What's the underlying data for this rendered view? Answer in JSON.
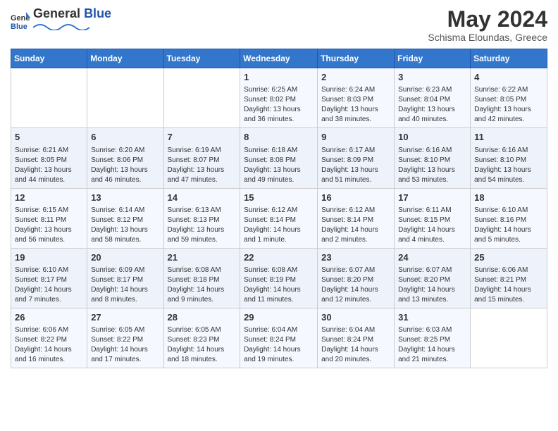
{
  "logo": {
    "text_general": "General",
    "text_blue": "Blue"
  },
  "header": {
    "title": "May 2024",
    "subtitle": "Schisma Eloundas, Greece"
  },
  "weekdays": [
    "Sunday",
    "Monday",
    "Tuesday",
    "Wednesday",
    "Thursday",
    "Friday",
    "Saturday"
  ],
  "weeks": [
    [
      {
        "day": "",
        "lines": []
      },
      {
        "day": "",
        "lines": []
      },
      {
        "day": "",
        "lines": []
      },
      {
        "day": "1",
        "lines": [
          "Sunrise: 6:25 AM",
          "Sunset: 8:02 PM",
          "Daylight: 13 hours",
          "and 36 minutes."
        ]
      },
      {
        "day": "2",
        "lines": [
          "Sunrise: 6:24 AM",
          "Sunset: 8:03 PM",
          "Daylight: 13 hours",
          "and 38 minutes."
        ]
      },
      {
        "day": "3",
        "lines": [
          "Sunrise: 6:23 AM",
          "Sunset: 8:04 PM",
          "Daylight: 13 hours",
          "and 40 minutes."
        ]
      },
      {
        "day": "4",
        "lines": [
          "Sunrise: 6:22 AM",
          "Sunset: 8:05 PM",
          "Daylight: 13 hours",
          "and 42 minutes."
        ]
      }
    ],
    [
      {
        "day": "5",
        "lines": [
          "Sunrise: 6:21 AM",
          "Sunset: 8:05 PM",
          "Daylight: 13 hours",
          "and 44 minutes."
        ]
      },
      {
        "day": "6",
        "lines": [
          "Sunrise: 6:20 AM",
          "Sunset: 8:06 PM",
          "Daylight: 13 hours",
          "and 46 minutes."
        ]
      },
      {
        "day": "7",
        "lines": [
          "Sunrise: 6:19 AM",
          "Sunset: 8:07 PM",
          "Daylight: 13 hours",
          "and 47 minutes."
        ]
      },
      {
        "day": "8",
        "lines": [
          "Sunrise: 6:18 AM",
          "Sunset: 8:08 PM",
          "Daylight: 13 hours",
          "and 49 minutes."
        ]
      },
      {
        "day": "9",
        "lines": [
          "Sunrise: 6:17 AM",
          "Sunset: 8:09 PM",
          "Daylight: 13 hours",
          "and 51 minutes."
        ]
      },
      {
        "day": "10",
        "lines": [
          "Sunrise: 6:16 AM",
          "Sunset: 8:10 PM",
          "Daylight: 13 hours",
          "and 53 minutes."
        ]
      },
      {
        "day": "11",
        "lines": [
          "Sunrise: 6:16 AM",
          "Sunset: 8:10 PM",
          "Daylight: 13 hours",
          "and 54 minutes."
        ]
      }
    ],
    [
      {
        "day": "12",
        "lines": [
          "Sunrise: 6:15 AM",
          "Sunset: 8:11 PM",
          "Daylight: 13 hours",
          "and 56 minutes."
        ]
      },
      {
        "day": "13",
        "lines": [
          "Sunrise: 6:14 AM",
          "Sunset: 8:12 PM",
          "Daylight: 13 hours",
          "and 58 minutes."
        ]
      },
      {
        "day": "14",
        "lines": [
          "Sunrise: 6:13 AM",
          "Sunset: 8:13 PM",
          "Daylight: 13 hours",
          "and 59 minutes."
        ]
      },
      {
        "day": "15",
        "lines": [
          "Sunrise: 6:12 AM",
          "Sunset: 8:14 PM",
          "Daylight: 14 hours",
          "and 1 minute."
        ]
      },
      {
        "day": "16",
        "lines": [
          "Sunrise: 6:12 AM",
          "Sunset: 8:14 PM",
          "Daylight: 14 hours",
          "and 2 minutes."
        ]
      },
      {
        "day": "17",
        "lines": [
          "Sunrise: 6:11 AM",
          "Sunset: 8:15 PM",
          "Daylight: 14 hours",
          "and 4 minutes."
        ]
      },
      {
        "day": "18",
        "lines": [
          "Sunrise: 6:10 AM",
          "Sunset: 8:16 PM",
          "Daylight: 14 hours",
          "and 5 minutes."
        ]
      }
    ],
    [
      {
        "day": "19",
        "lines": [
          "Sunrise: 6:10 AM",
          "Sunset: 8:17 PM",
          "Daylight: 14 hours",
          "and 7 minutes."
        ]
      },
      {
        "day": "20",
        "lines": [
          "Sunrise: 6:09 AM",
          "Sunset: 8:17 PM",
          "Daylight: 14 hours",
          "and 8 minutes."
        ]
      },
      {
        "day": "21",
        "lines": [
          "Sunrise: 6:08 AM",
          "Sunset: 8:18 PM",
          "Daylight: 14 hours",
          "and 9 minutes."
        ]
      },
      {
        "day": "22",
        "lines": [
          "Sunrise: 6:08 AM",
          "Sunset: 8:19 PM",
          "Daylight: 14 hours",
          "and 11 minutes."
        ]
      },
      {
        "day": "23",
        "lines": [
          "Sunrise: 6:07 AM",
          "Sunset: 8:20 PM",
          "Daylight: 14 hours",
          "and 12 minutes."
        ]
      },
      {
        "day": "24",
        "lines": [
          "Sunrise: 6:07 AM",
          "Sunset: 8:20 PM",
          "Daylight: 14 hours",
          "and 13 minutes."
        ]
      },
      {
        "day": "25",
        "lines": [
          "Sunrise: 6:06 AM",
          "Sunset: 8:21 PM",
          "Daylight: 14 hours",
          "and 15 minutes."
        ]
      }
    ],
    [
      {
        "day": "26",
        "lines": [
          "Sunrise: 6:06 AM",
          "Sunset: 8:22 PM",
          "Daylight: 14 hours",
          "and 16 minutes."
        ]
      },
      {
        "day": "27",
        "lines": [
          "Sunrise: 6:05 AM",
          "Sunset: 8:22 PM",
          "Daylight: 14 hours",
          "and 17 minutes."
        ]
      },
      {
        "day": "28",
        "lines": [
          "Sunrise: 6:05 AM",
          "Sunset: 8:23 PM",
          "Daylight: 14 hours",
          "and 18 minutes."
        ]
      },
      {
        "day": "29",
        "lines": [
          "Sunrise: 6:04 AM",
          "Sunset: 8:24 PM",
          "Daylight: 14 hours",
          "and 19 minutes."
        ]
      },
      {
        "day": "30",
        "lines": [
          "Sunrise: 6:04 AM",
          "Sunset: 8:24 PM",
          "Daylight: 14 hours",
          "and 20 minutes."
        ]
      },
      {
        "day": "31",
        "lines": [
          "Sunrise: 6:03 AM",
          "Sunset: 8:25 PM",
          "Daylight: 14 hours",
          "and 21 minutes."
        ]
      },
      {
        "day": "",
        "lines": []
      }
    ]
  ]
}
